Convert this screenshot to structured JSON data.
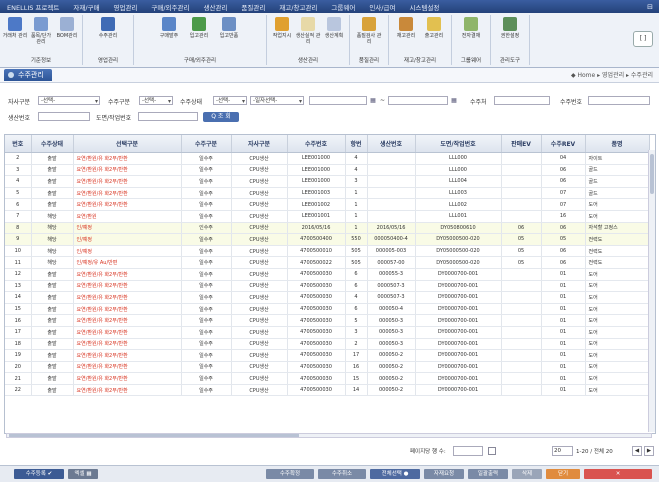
{
  "menubar": {
    "items": [
      "ENELLIS 프로젝트",
      "자재/구매",
      "영업관리",
      "구매/외주관리",
      "생산관리",
      "품질관리",
      "재고/창고관리",
      "그룹웨어",
      "인사/급여",
      "시스템설정"
    ],
    "right_icon": "window-controls"
  },
  "ribbon": {
    "groups": [
      {
        "label": "기준정보",
        "buttons": [
          "거래처 관리",
          "품목/단가 관리",
          "BOM관리"
        ]
      },
      {
        "label": "영업관리",
        "buttons": [
          "수주관리"
        ]
      },
      {
        "label": "구매/외주관리",
        "buttons": [
          "구매발주",
          "입고관리",
          "입고반품"
        ]
      },
      {
        "label": "생산관리",
        "buttons": [
          "작업지시",
          "생산실적 관리",
          "생산계획"
        ]
      },
      {
        "label": "품질관리",
        "buttons": [
          "품질검사 관리"
        ]
      },
      {
        "label": "재고/창고관리",
        "buttons": [
          "재고관리",
          "출고관리"
        ]
      },
      {
        "label": "그룹웨어",
        "buttons": [
          "전자결재"
        ]
      },
      {
        "label": "관리도구",
        "buttons": [
          "권한설정"
        ]
      }
    ],
    "right_label": "[ ]"
  },
  "titlebar": {
    "tab": "수주관리",
    "breadcrumb": "◆ Home ▸ 영업관리 ▸ 수주관리"
  },
  "filters": {
    "row1": [
      {
        "label": "자사구분",
        "value": "-선택-"
      },
      {
        "label": "수주구분",
        "value": "-선택-"
      },
      {
        "label": "수주상태",
        "value": "-선택-"
      },
      {
        "label": "",
        "value": "-일자선택-"
      },
      {
        "label": "",
        "value": ""
      },
      {
        "label": "~",
        "value": ""
      },
      {
        "label": "수주처",
        "value": ""
      },
      {
        "label": "수주번호",
        "value": ""
      }
    ],
    "row2": [
      {
        "label": "생산번호",
        "value": ""
      },
      {
        "label": "도면/작업번호",
        "value": ""
      }
    ],
    "search_label": "Q 조 회"
  },
  "table": {
    "columns": [
      "번호",
      "수주상태",
      "선택구분",
      "수주구분",
      "자사구분",
      "수주번호",
      "항번",
      "생산번호",
      "도면/작업번호",
      "판매EV",
      "수주REV",
      "품명"
    ],
    "rows": [
      [
        "2",
        "출발",
        "요연/환원/유 화2부/반환",
        "일수주",
        "CPU생산",
        "LEE001000",
        "4",
        "",
        "LLL000",
        "",
        "04",
        "자이트"
      ],
      [
        "3",
        "출발",
        "요연/환원/유 화2부/반환",
        "일수주",
        "CPU생산",
        "LEE001000",
        "4",
        "",
        "LLL000",
        "",
        "06",
        "골드"
      ],
      [
        "4",
        "출발",
        "요연/환원/유 화2부/반환",
        "일수주",
        "CPU생산",
        "LEE001000",
        "3",
        "",
        "LLL004",
        "",
        "06",
        "골드"
      ],
      [
        "5",
        "출발",
        "요연/환원/유 화2부/반환",
        "일수주",
        "CPU생산",
        "LEE001003",
        "1",
        "",
        "LLL003",
        "",
        "07",
        "골드"
      ],
      [
        "6",
        "출발",
        "요연/환원/유 화2부/반환",
        "일수주",
        "CPU생산",
        "LEE001002",
        "1",
        "",
        "LLL002",
        "",
        "07",
        "도어"
      ],
      [
        "7",
        "해당",
        "요연/환원",
        "일수주",
        "CPU생산",
        "LEE001001",
        "1",
        "",
        "LLL001",
        "",
        "16",
        "도어"
      ],
      [
        "8",
        "해당",
        "인/예정",
        "인수주",
        "CPU생산",
        "2016/05/16",
        "1",
        "2016/05/16",
        "DY050800610",
        "06",
        "06",
        "자석할 고정스"
      ],
      [
        "9",
        "해당",
        "인/예정",
        "일수주",
        "CPU생산",
        "4700500400",
        "550",
        "000050400-4",
        "DY05000500-020",
        "05",
        "05",
        "전력도"
      ],
      [
        "10",
        "해당",
        "인/예정",
        "일수주",
        "CPU생산",
        "4700500010",
        "505",
        "000005-003",
        "DY05000500-020",
        "05",
        "06",
        "전력도"
      ],
      [
        "11",
        "해당",
        "인/예정/유 Au/반편",
        "일수주",
        "CPU생산",
        "4700500022",
        "505",
        "000057-00",
        "DY05000500-020",
        "05",
        "06",
        "전력도"
      ],
      [
        "12",
        "출발",
        "요연/환원/유 화2부/반환",
        "일수주",
        "CPU생산",
        "4700500030",
        "6",
        "000055-3",
        "DY0000700-001",
        "",
        "01",
        "도어"
      ],
      [
        "13",
        "출발",
        "요연/환원/유 화2부/반환",
        "일수주",
        "CPU생산",
        "4700500030",
        "6",
        "0000507-3",
        "DY0000700-001",
        "",
        "01",
        "도어"
      ],
      [
        "14",
        "출발",
        "요연/환원/유 화2부/반환",
        "일수주",
        "CPU생산",
        "4700500030",
        "4",
        "0000507-3",
        "DY0000700-001",
        "",
        "01",
        "도어"
      ],
      [
        "15",
        "출발",
        "요연/환원/유 화2부/반환",
        "일수주",
        "CPU생산",
        "4700500030",
        "6",
        "000050-4",
        "DY0000700-001",
        "",
        "01",
        "도어"
      ],
      [
        "16",
        "출발",
        "요연/환원/유 화2부/반환",
        "일수주",
        "CPU생산",
        "4700500030",
        "5",
        "000050-3",
        "DY0000700-001",
        "",
        "01",
        "도어"
      ],
      [
        "17",
        "출발",
        "요연/환원/유 화2부/반환",
        "일수주",
        "CPU생산",
        "4700500030",
        "3",
        "000050-3",
        "DY0000700-001",
        "",
        "01",
        "도어"
      ],
      [
        "18",
        "출발",
        "요연/환원/유 화2부/반환",
        "일수주",
        "CPU생산",
        "4700500030",
        "2",
        "000050-3",
        "DY0000700-001",
        "",
        "01",
        "도어"
      ],
      [
        "19",
        "출발",
        "요연/환원/유 화2부/반환",
        "일수주",
        "CPU생산",
        "4700500030",
        "17",
        "000050-2",
        "DY0000700-001",
        "",
        "01",
        "도어"
      ],
      [
        "20",
        "출발",
        "요연/환원/유 화2부/반환",
        "일수주",
        "CPU생산",
        "4700500030",
        "16",
        "000050-2",
        "DY0000700-001",
        "",
        "01",
        "도어"
      ],
      [
        "21",
        "출발",
        "요연/환원/유 화2부/반환",
        "일수주",
        "CPU생산",
        "4700500030",
        "15",
        "000050-2",
        "DY0000700-001",
        "",
        "01",
        "도어"
      ],
      [
        "22",
        "출발",
        "요연/환원/유 화2부/반환",
        "일수주",
        "CPU생산",
        "4700500030",
        "14",
        "000050-2",
        "DY0000700-001",
        "",
        "01",
        "도어"
      ]
    ]
  },
  "pager": {
    "rows_per_page_label": "페이지당 행 수:",
    "rows_per_page_value": "20",
    "range_text": "1-20 / 전체 20",
    "checkbox_label": "",
    "nav": [
      "◀",
      "▶"
    ]
  },
  "bottom_buttons": {
    "left": [
      "수주등록 ✔",
      "엑셀 ▦"
    ],
    "right": [
      "수주확정",
      "수주취소",
      "전체선택 ●",
      "자재요청",
      "일괄출력",
      "삭제",
      "닫기"
    ]
  }
}
